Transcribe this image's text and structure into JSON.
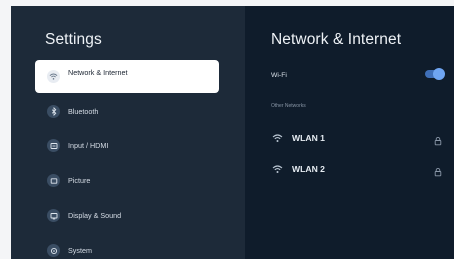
{
  "settings": {
    "title": "Settings",
    "menu": [
      {
        "label": "Network & Internet",
        "icon": "wifi-icon",
        "selected": true
      },
      {
        "label": "Bluetooth",
        "icon": "bluetooth-icon",
        "selected": false
      },
      {
        "label": "Input / HDMI",
        "icon": "input-icon",
        "selected": false
      },
      {
        "label": "Picture",
        "icon": "picture-icon",
        "selected": false
      },
      {
        "label": "Display & Sound",
        "icon": "display-icon",
        "selected": false
      },
      {
        "label": "System",
        "icon": "system-icon",
        "selected": false
      }
    ]
  },
  "network": {
    "title": "Network & Internet",
    "wifi_label": "Wi-Fi",
    "wifi_enabled": true,
    "other_networks_label": "Other Networks",
    "networks": [
      {
        "name": "WLAN 1",
        "locked": true
      },
      {
        "name": "WLAN 2",
        "locked": true
      }
    ]
  },
  "colors": {
    "left_panel": "#1d2a39",
    "right_panel": "#0f1c2b",
    "accent": "#6fa5f2",
    "selected_bg": "#ffffff"
  }
}
